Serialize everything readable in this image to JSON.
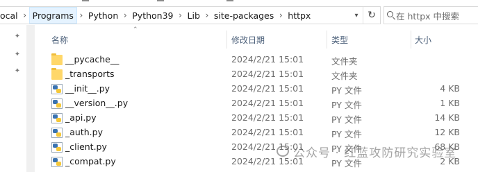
{
  "address_bar": {
    "crumbs": [
      "ocal",
      "Programs",
      "Python",
      "Python39",
      "Lib",
      "site-packages",
      "httpx"
    ],
    "separator": "›"
  },
  "search": {
    "placeholder": "在 httpx 中搜索"
  },
  "columns": {
    "name": "名称",
    "date": "修改日期",
    "type": "类型",
    "size": "大小"
  },
  "files": [
    {
      "name": "__pycache__",
      "date": "2024/2/21 15:01",
      "type": "文件夹",
      "size": "",
      "icon": "folder-icon"
    },
    {
      "name": "_transports",
      "date": "2024/2/21 15:01",
      "type": "文件夹",
      "size": "",
      "icon": "folder-icon"
    },
    {
      "name": "__init__.py",
      "date": "2024/2/21 15:01",
      "type": "PY 文件",
      "size": "4 KB",
      "icon": "python-file-icon"
    },
    {
      "name": "__version__.py",
      "date": "2024/2/21 15:01",
      "type": "PY 文件",
      "size": "1 KB",
      "icon": "python-file-icon"
    },
    {
      "name": "_api.py",
      "date": "2024/2/21 15:01",
      "type": "PY 文件",
      "size": "14 KB",
      "icon": "python-file-icon"
    },
    {
      "name": "_auth.py",
      "date": "2024/2/21 15:01",
      "type": "PY 文件",
      "size": "12 KB",
      "icon": "python-file-icon"
    },
    {
      "name": "_client.py",
      "date": "2024/2/21 15:01",
      "type": "PY 文件",
      "size": "68 KB",
      "icon": "python-file-icon"
    },
    {
      "name": "_compat.py",
      "date": "2024/2/21 15:01",
      "type": "PY 文件",
      "size": "2 KB",
      "icon": "python-file-icon"
    }
  ],
  "watermark": {
    "text": "公众号 · 红蓝攻防研究实验室"
  }
}
